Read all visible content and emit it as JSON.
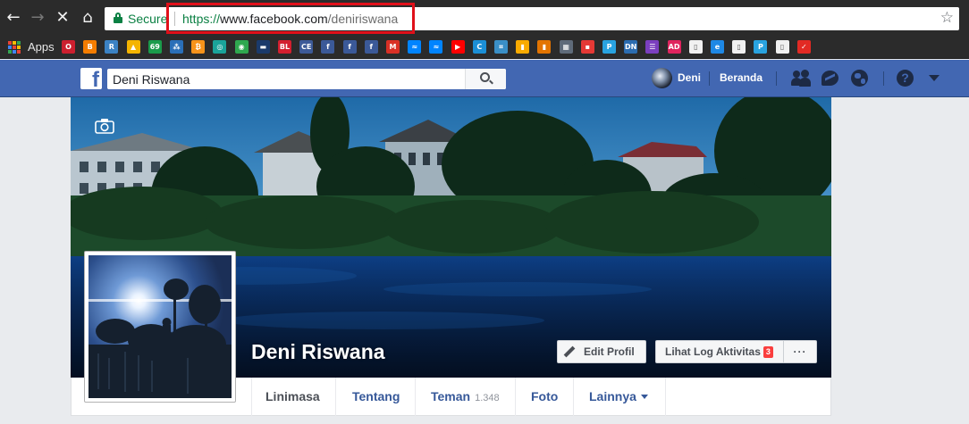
{
  "browser": {
    "secure_label": "Secure",
    "url": {
      "scheme": "https://",
      "host": "www.facebook.com",
      "path": "/deniriswana"
    },
    "url_highlight_color": "#e0101a",
    "nav_icons": [
      "back-arrow-icon",
      "forward-arrow-icon",
      "stop-loading-icon",
      "home-icon"
    ],
    "bookmark_star_icon": "star-icon"
  },
  "bookmarks": {
    "apps_label": "Apps",
    "items": [
      {
        "icon": "opera-icon",
        "glyph": "O",
        "color": "#cc1f2f"
      },
      {
        "icon": "blogger-icon",
        "glyph": "B",
        "color": "#f57d00"
      },
      {
        "icon": "r-square-icon",
        "glyph": "R",
        "color": "#3b82c4"
      },
      {
        "icon": "adsense-icon",
        "glyph": "▲",
        "color": "#f4b400"
      },
      {
        "icon": "69-badge-icon",
        "glyph": "69",
        "color": "#1a9b4b"
      },
      {
        "icon": "diamond-dots-icon",
        "glyph": "⁂",
        "color": "#2a6fb8"
      },
      {
        "icon": "bitcoin-icon",
        "glyph": "₿",
        "color": "#f7931a"
      },
      {
        "icon": "teal-swirl-icon",
        "glyph": "◎",
        "color": "#1aa39a"
      },
      {
        "icon": "target-icon",
        "glyph": "◉",
        "color": "#2fa84f"
      },
      {
        "icon": "dark-banner-icon",
        "glyph": "▬",
        "color": "#1a3a6b"
      },
      {
        "icon": "bl-icon",
        "glyph": "BL",
        "color": "#d31f2f"
      },
      {
        "icon": "ce-icon",
        "glyph": "CE",
        "color": "#3d5a98"
      },
      {
        "icon": "facebook-bookmark-icon",
        "glyph": "f",
        "color": "#3b5998"
      },
      {
        "icon": "facebook-bookmark-icon",
        "glyph": "f",
        "color": "#3b5998"
      },
      {
        "icon": "facebook-bookmark-icon",
        "glyph": "f",
        "color": "#3b5998"
      },
      {
        "icon": "gmail-icon",
        "glyph": "M",
        "color": "#d93025"
      },
      {
        "icon": "messenger-bookmark-icon",
        "glyph": "≈",
        "color": "#0084ff"
      },
      {
        "icon": "messenger-bookmark-icon",
        "glyph": "≈",
        "color": "#0084ff"
      },
      {
        "icon": "youtube-icon",
        "glyph": "▶",
        "color": "#ff0000"
      },
      {
        "icon": "c-circle-icon",
        "glyph": "C",
        "color": "#1b8fd6"
      },
      {
        "icon": "grid-tree-icon",
        "glyph": "⌗",
        "color": "#3a8fc6"
      },
      {
        "icon": "analytics-icon",
        "glyph": "▮",
        "color": "#f9ab00"
      },
      {
        "icon": "bar-chart-icon",
        "glyph": "▮",
        "color": "#e37400"
      },
      {
        "icon": "calendar-icon",
        "glyph": "▦",
        "color": "#5f6b7a"
      },
      {
        "icon": "red-squares-icon",
        "glyph": "▪",
        "color": "#e53935"
      },
      {
        "icon": "p-icon",
        "glyph": "P",
        "color": "#29a3e0"
      },
      {
        "icon": "dn-icon",
        "glyph": "DN",
        "color": "#2b6cb0"
      },
      {
        "icon": "list-icon",
        "glyph": "☰",
        "color": "#7b3fbf"
      },
      {
        "icon": "ad-icon",
        "glyph": "AD",
        "color": "#e0245e"
      },
      {
        "icon": "document-icon",
        "glyph": "▯",
        "color": "#f1f1f1"
      },
      {
        "icon": "edge-icon",
        "glyph": "e",
        "color": "#1e88e5"
      },
      {
        "icon": "document-icon",
        "glyph": "▯",
        "color": "#f1f1f1"
      },
      {
        "icon": "p-icon",
        "glyph": "P",
        "color": "#29a3e0"
      },
      {
        "icon": "document-icon",
        "glyph": "▯",
        "color": "#f1f1f1"
      },
      {
        "icon": "nike-swoosh-icon",
        "glyph": "✓",
        "color": "#e22a24"
      }
    ]
  },
  "fb_topbar": {
    "search_value": "Deni Riswana",
    "user_name": "Deni",
    "home_label": "Beranda",
    "brand_color": "#4267b2"
  },
  "profile": {
    "name": "Deni Riswana",
    "edit_profile_label": "Edit Profil",
    "activity_log_label": "Lihat Log Aktivitas",
    "activity_log_count": "3",
    "more_label": "···"
  },
  "tabs": [
    {
      "label": "Linimasa",
      "active": true
    },
    {
      "label": "Tentang"
    },
    {
      "label": "Teman",
      "count": "1.348"
    },
    {
      "label": "Foto"
    },
    {
      "label": "Lainnya"
    }
  ]
}
